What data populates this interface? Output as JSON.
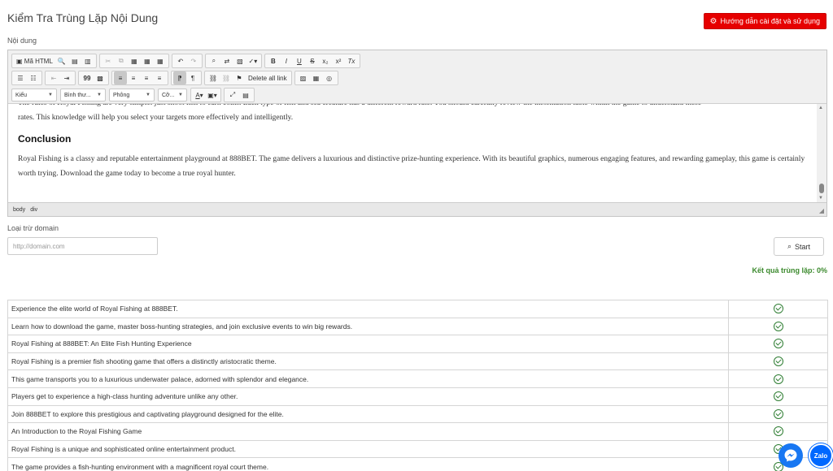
{
  "header": {
    "title": "Kiểm Tra Trùng Lặp Nội Dung",
    "guide_button": "Hướng dẫn cài đặt và sử dụng"
  },
  "content_label": "Nội dung",
  "editor": {
    "toolbar": {
      "source_label": "Mã HTML",
      "delete_all_link": "Delete all link",
      "style_combo": "Kiểu",
      "format_combo": "Bình thư...",
      "font_combo": "Phông",
      "size_combo": "Cỡ...",
      "btn_bold": "B",
      "btn_italic": "I",
      "btn_underline": "U",
      "btn_strike": "S",
      "btn_subscript": "x₂",
      "btn_superscript": "x²",
      "btn_remove_format": "Tx",
      "btn_blockquote": "99"
    },
    "content": {
      "partial_line": "The rules of Royal Fishing are very simple: just shoot fish to earn coins. Each type of fish and sea creature has a different reward rate. You should carefully review the information table within the game to understand these",
      "line_1": "rates. This knowledge will help you select your targets more effectively and intelligently.",
      "heading": "Conclusion",
      "paragraph": "Royal Fishing is a classy and reputable entertainment playground at 888BET. The game delivers a luxurious and distinctive prize-hunting experience. With its beautiful graphics, numerous engaging features, and rewarding gameplay, this game is certainly worth trying. Download the game today to become a true royal hunter."
    },
    "statusbar": [
      "body",
      "div"
    ]
  },
  "exclude_domain": {
    "label": "Loại trừ domain",
    "placeholder": "http://domain.com"
  },
  "start_button": "Start",
  "result_summary": "Kết quả trùng lặp: 0%",
  "results": [
    {
      "text": "Experience the elite world of Royal Fishing at 888BET.",
      "status": "ok"
    },
    {
      "text": "Learn how to download the game, master boss-hunting strategies, and join exclusive events to win big rewards.",
      "status": "ok"
    },
    {
      "text": "Royal Fishing at 888BET: An Elite Fish Hunting Experience",
      "status": "ok"
    },
    {
      "text": "Royal Fishing is a premier fish shooting game that offers a distinctly aristocratic theme.",
      "status": "ok"
    },
    {
      "text": "This game transports you to a luxurious underwater palace, adorned with splendor and elegance.",
      "status": "ok"
    },
    {
      "text": "Players get to experience a high-class hunting adventure unlike any other.",
      "status": "ok"
    },
    {
      "text": "Join 888BET to explore this prestigious and captivating playground designed for the elite.",
      "status": "ok"
    },
    {
      "text": "An Introduction to the Royal Fishing Game",
      "status": "ok"
    },
    {
      "text": "Royal Fishing is a unique and sophisticated online entertainment product.",
      "status": "ok"
    },
    {
      "text": "The game provides a fish-hunting environment with a magnificent royal court theme.",
      "status": "ok"
    }
  ],
  "floating": {
    "zalo_label": "Zalo"
  },
  "colors": {
    "accent_red": "#e60000",
    "success_green": "#2e7d32"
  }
}
